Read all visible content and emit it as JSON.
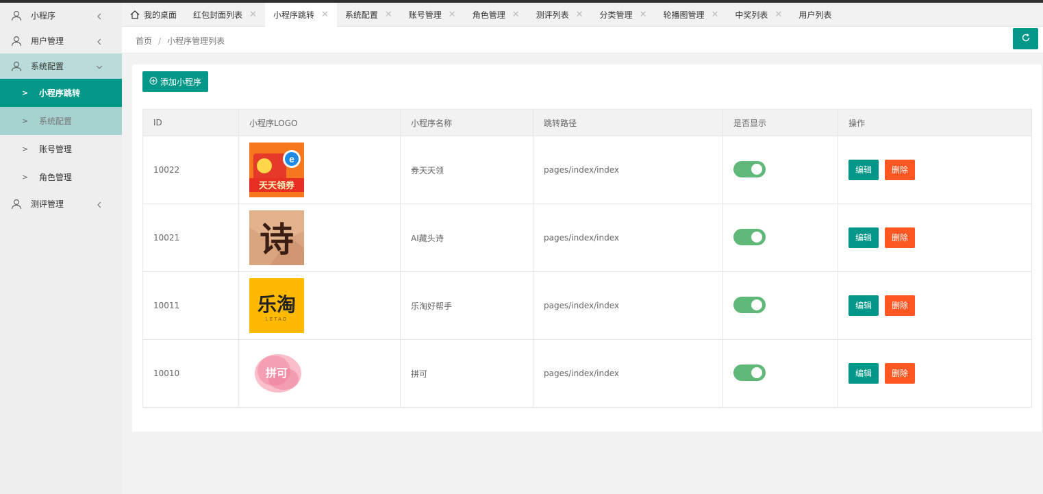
{
  "sidebar": {
    "items": [
      {
        "label": "小程序",
        "icon": "user-icon",
        "expanded": false
      },
      {
        "label": "用户管理",
        "icon": "user-icon",
        "expanded": false
      },
      {
        "label": "系统配置",
        "icon": "user-icon",
        "expanded": true,
        "children": [
          {
            "label": "小程序跳转",
            "state": "active"
          },
          {
            "label": "系统配置",
            "state": "dim"
          },
          {
            "label": "账号管理",
            "state": "normal"
          },
          {
            "label": "角色管理",
            "state": "normal"
          }
        ]
      },
      {
        "label": "测评管理",
        "icon": "user-icon",
        "expanded": false
      }
    ]
  },
  "tabs": [
    {
      "label": "我的桌面",
      "home": true,
      "closable": false
    },
    {
      "label": "红包封面列表",
      "closable": true
    },
    {
      "label": "小程序跳转",
      "closable": true,
      "active": true
    },
    {
      "label": "系统配置",
      "closable": true
    },
    {
      "label": "账号管理",
      "closable": true
    },
    {
      "label": "角色管理",
      "closable": true
    },
    {
      "label": "测评列表",
      "closable": true
    },
    {
      "label": "分类管理",
      "closable": true
    },
    {
      "label": "轮播图管理",
      "closable": true
    },
    {
      "label": "中奖列表",
      "closable": true
    },
    {
      "label": "用户列表",
      "closable": false
    }
  ],
  "breadcrumb": {
    "home": "首页",
    "sep": "/",
    "current": "小程序管理列表"
  },
  "toolbar": {
    "add_label": "添加小程序"
  },
  "table": {
    "headers": [
      "ID",
      "小程序LOGO",
      "小程序名称",
      "跳转路径",
      "是否显示",
      "操作"
    ],
    "rows": [
      {
        "id": "10022",
        "logo": "quan-tiantian-logo",
        "logo_text": "天天领券",
        "name": "券天天领",
        "path": "pages/index/index",
        "show": true
      },
      {
        "id": "10021",
        "logo": "ai-poem-logo",
        "logo_text": "诗",
        "name": "AI藏头诗",
        "path": "pages/index/index",
        "show": true
      },
      {
        "id": "10011",
        "logo": "letao-logo",
        "logo_text": "乐淘",
        "logo_sub": "LETAO",
        "name": "乐淘好帮手",
        "path": "pages/index/index",
        "show": true
      },
      {
        "id": "10010",
        "logo": "pinke-logo",
        "logo_text": "拼可",
        "name": "拼可",
        "path": "pages/index/index",
        "show": true
      }
    ],
    "edit_label": "编辑",
    "delete_label": "删除"
  },
  "colors": {
    "primary": "#009688",
    "danger": "#ff5722",
    "switch_on": "#5fb878"
  }
}
